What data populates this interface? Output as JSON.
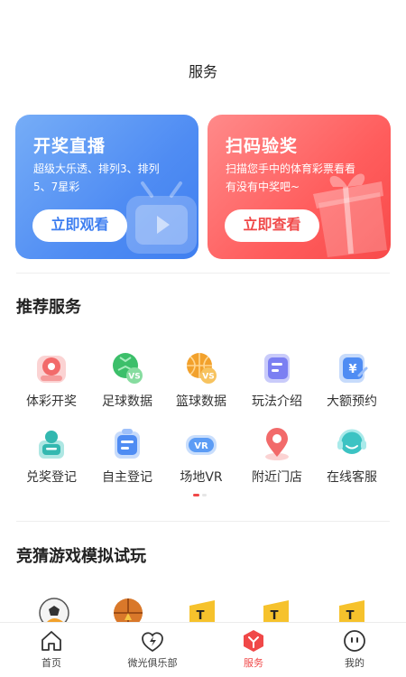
{
  "header": {
    "title": "服务"
  },
  "banners": [
    {
      "title": "开奖直播",
      "desc": "超级大乐透、排列3、排列5、7星彩",
      "button": "立即观看",
      "icon": "tv-icon"
    },
    {
      "title": "扫码验奖",
      "desc": "扫描您手中的体育彩票看看有没有中奖吧~",
      "button": "立即查看",
      "icon": "gift-icon"
    }
  ],
  "recommend": {
    "title": "推荐服务",
    "items": [
      {
        "label": "体彩开奖",
        "icon": "lottery-draw-icon",
        "color": "#f26a6a"
      },
      {
        "label": "足球数据",
        "icon": "football-data-icon",
        "color": "#3cbf6a"
      },
      {
        "label": "篮球数据",
        "icon": "basketball-data-icon",
        "color": "#f2a12c"
      },
      {
        "label": "玩法介绍",
        "icon": "rules-intro-icon",
        "color": "#7b7ff2"
      },
      {
        "label": "大额预约",
        "icon": "large-reservation-icon",
        "color": "#4f8cf3"
      },
      {
        "label": "兑奖登记",
        "icon": "prize-register-icon",
        "color": "#33b8b0"
      },
      {
        "label": "自主登记",
        "icon": "self-register-icon",
        "color": "#4f8cf3"
      },
      {
        "label": "场地VR",
        "icon": "venue-vr-icon",
        "color": "#5c9cf5"
      },
      {
        "label": "附近门店",
        "icon": "nearby-store-icon",
        "color": "#f26a6a"
      },
      {
        "label": "在线客服",
        "icon": "online-service-icon",
        "color": "#3cc3c3"
      }
    ]
  },
  "games": {
    "title": "竞猜游戏模拟试玩",
    "items": [
      {
        "icon": "soccer-ball-icon"
      },
      {
        "icon": "basketball-icon"
      },
      {
        "icon": "game-badge-icon"
      },
      {
        "icon": "game-badge-icon"
      },
      {
        "icon": "game-badge-icon"
      }
    ]
  },
  "tabbar": {
    "items": [
      {
        "label": "首页",
        "icon": "home-icon"
      },
      {
        "label": "微光俱乐部",
        "icon": "club-bolt-icon"
      },
      {
        "label": "服务",
        "icon": "service-icon",
        "active": true
      },
      {
        "label": "我的",
        "icon": "profile-icon"
      }
    ],
    "active_color": "#f04848"
  }
}
